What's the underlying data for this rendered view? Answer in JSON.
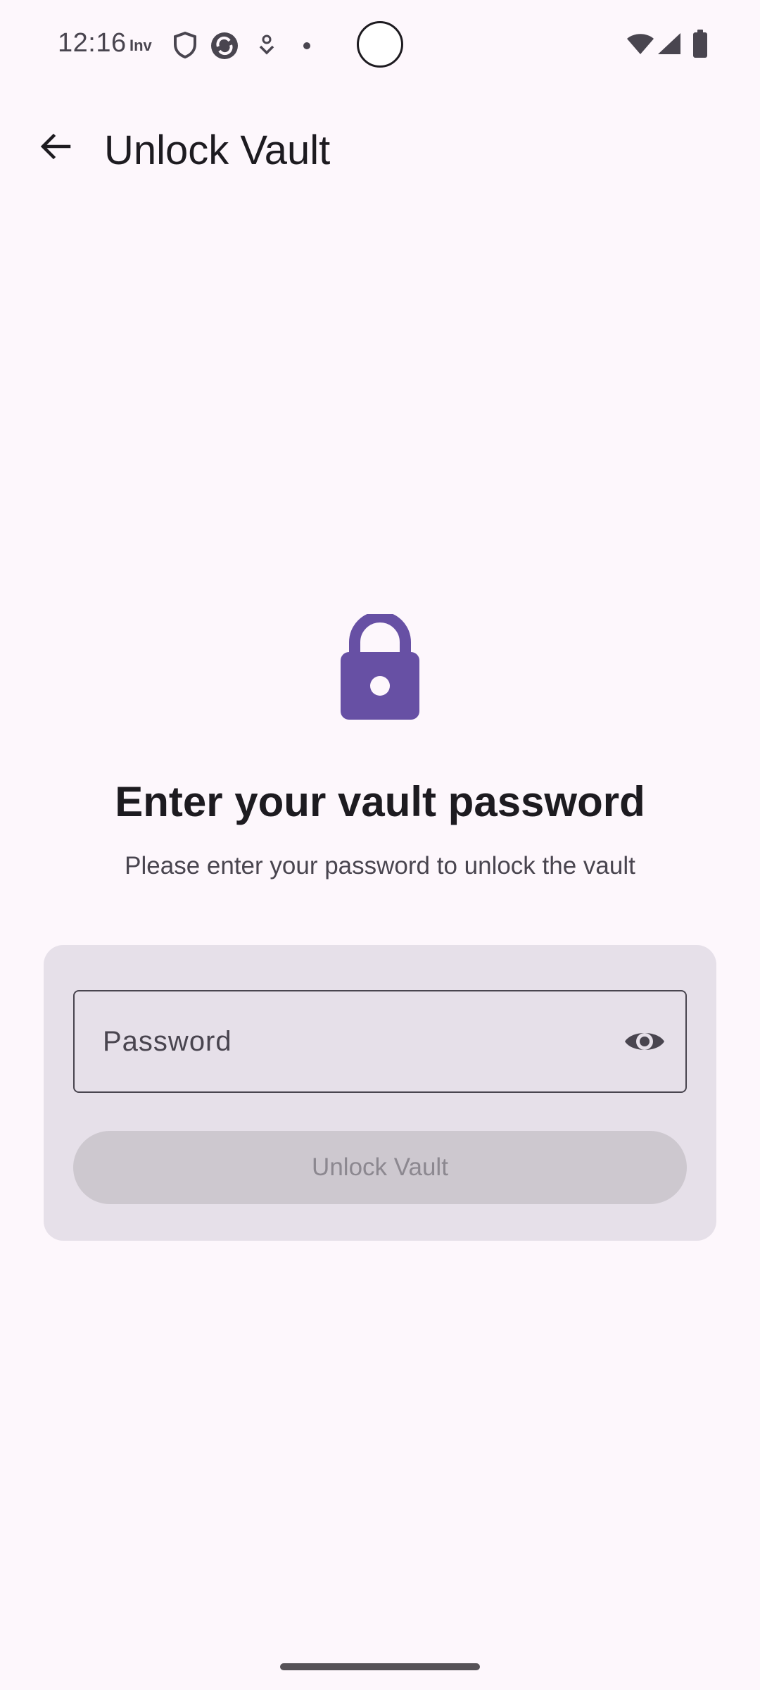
{
  "status_bar": {
    "time": "12:16",
    "notification_icons": [
      "inv-icon",
      "shield-icon",
      "sync-icon",
      "download-icon",
      "dot-icon"
    ],
    "system_icons": [
      "wifi-icon",
      "signal-icon",
      "battery-icon"
    ]
  },
  "app_bar": {
    "back_icon": "arrow-back-icon",
    "title": "Unlock Vault"
  },
  "content": {
    "lock_icon": "lock-icon",
    "heading": "Enter your vault password",
    "subheading": "Please enter your password to unlock the vault"
  },
  "form": {
    "password_value": "",
    "password_placeholder": "Password",
    "visibility_icon": "eye-icon",
    "unlock_label": "Unlock Vault",
    "unlock_enabled": false
  },
  "colors": {
    "background": "#fdf7fc",
    "accent": "#6750a4",
    "card": "#e6e0e9",
    "disabled_button": "#cdc8cf"
  }
}
